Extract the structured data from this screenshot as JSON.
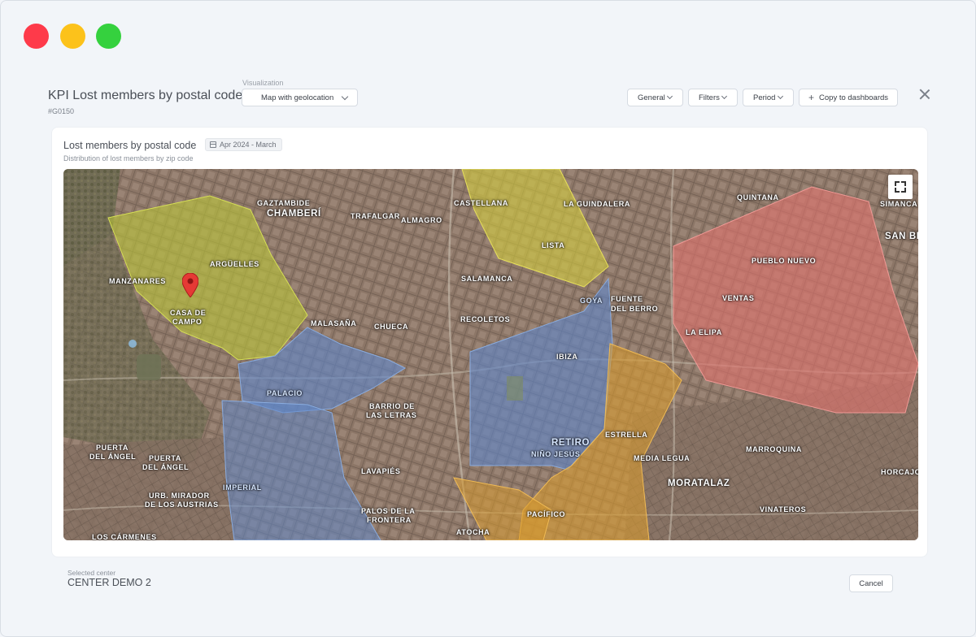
{
  "window": {
    "controls": [
      "close",
      "minimize",
      "maximize"
    ],
    "colors": {
      "close": "#fe3a4a",
      "minimize": "#fcc21b",
      "maximize": "#35d13e"
    }
  },
  "header": {
    "title": "KPI Lost members by postal code",
    "code": "#G0150",
    "visualization_label": "Visualization",
    "visualization_value": "Map with geolocation",
    "general_label": "General",
    "filters_label": "Filters",
    "period_label": "Period",
    "copy_label": "Copy to dashboards"
  },
  "card": {
    "title": "Lost members by postal code",
    "date_range": "Apr 2024 - March",
    "subtitle": "Distribution of lost members by zip code"
  },
  "map": {
    "zone_colors": {
      "green": "#b9c43a",
      "yellow": "#d4cd3e",
      "blue": "#5f86c9",
      "orange": "#d89b2e",
      "red": "#e0726e"
    },
    "labels": {
      "gaztambide": "GAZTAMBIDE",
      "chamberi": "CHAMBERÍ",
      "trafalgar": "TRAFALGAR",
      "almagro": "ALMAGRO",
      "castellana": "CASTELLANA",
      "guindalera": "LA GUINDALERA",
      "quintana": "QUINTANA",
      "simancas": "SIMANCA",
      "sanbl": "SAN BL",
      "arguelles": "ARGÜELLES",
      "manzanares": "MANZANARES",
      "lista": "LISTA",
      "pueblo_nuevo": "PUEBLO NUEVO",
      "salamanca": "SALAMANCA",
      "casa_de": "CASA DE",
      "campo": "CAMPO",
      "goya": "GOYA",
      "fuente_del": "FUENTE",
      "berro": "DEL BERRO",
      "ventas": "VENTAS",
      "malasana": "MALASAÑA",
      "chueca": "CHUECA",
      "recoletos": "RECOLETOS",
      "la_elipa": "LA ELIPA",
      "ibiza": "IBIZA",
      "palacio": "PALACIO",
      "barrio_de": "BARRIO DE",
      "las_letras": "LAS LETRAS",
      "estrella": "ESTRELLA",
      "retiro": "RETIRO",
      "nino_jesus": "NIÑO JESÚS",
      "puerta_angel_1a": "PUERTA",
      "puerta_angel_1b": "DEL ÁNGEL",
      "puerta_angel_2a": "PUERTA",
      "puerta_angel_2b": "DEL ÁNGEL",
      "media_legua": "MEDIA LEGUA",
      "marroquina": "MARROQUINA",
      "lavapies": "LAVAPIÉS",
      "horcajo": "HORCAJO",
      "moratalaz": "MORATALAZ",
      "imperial": "IMPERIAL",
      "mirador_a": "URB. MIRADOR",
      "mirador_b": "DE LOS AUSTRIAS",
      "palos_a": "PALOS DE LA",
      "palos_b": "FRONTERA",
      "pacifico": "PACÍFICO",
      "vinateros": "VINATEROS",
      "carmenes": "LOS CÁRMENES",
      "atocha": "ATOCHA"
    }
  },
  "footer": {
    "selected_label": "Selected center",
    "selected_value": "CENTER DEMO 2",
    "cancel_label": "Cancel"
  }
}
